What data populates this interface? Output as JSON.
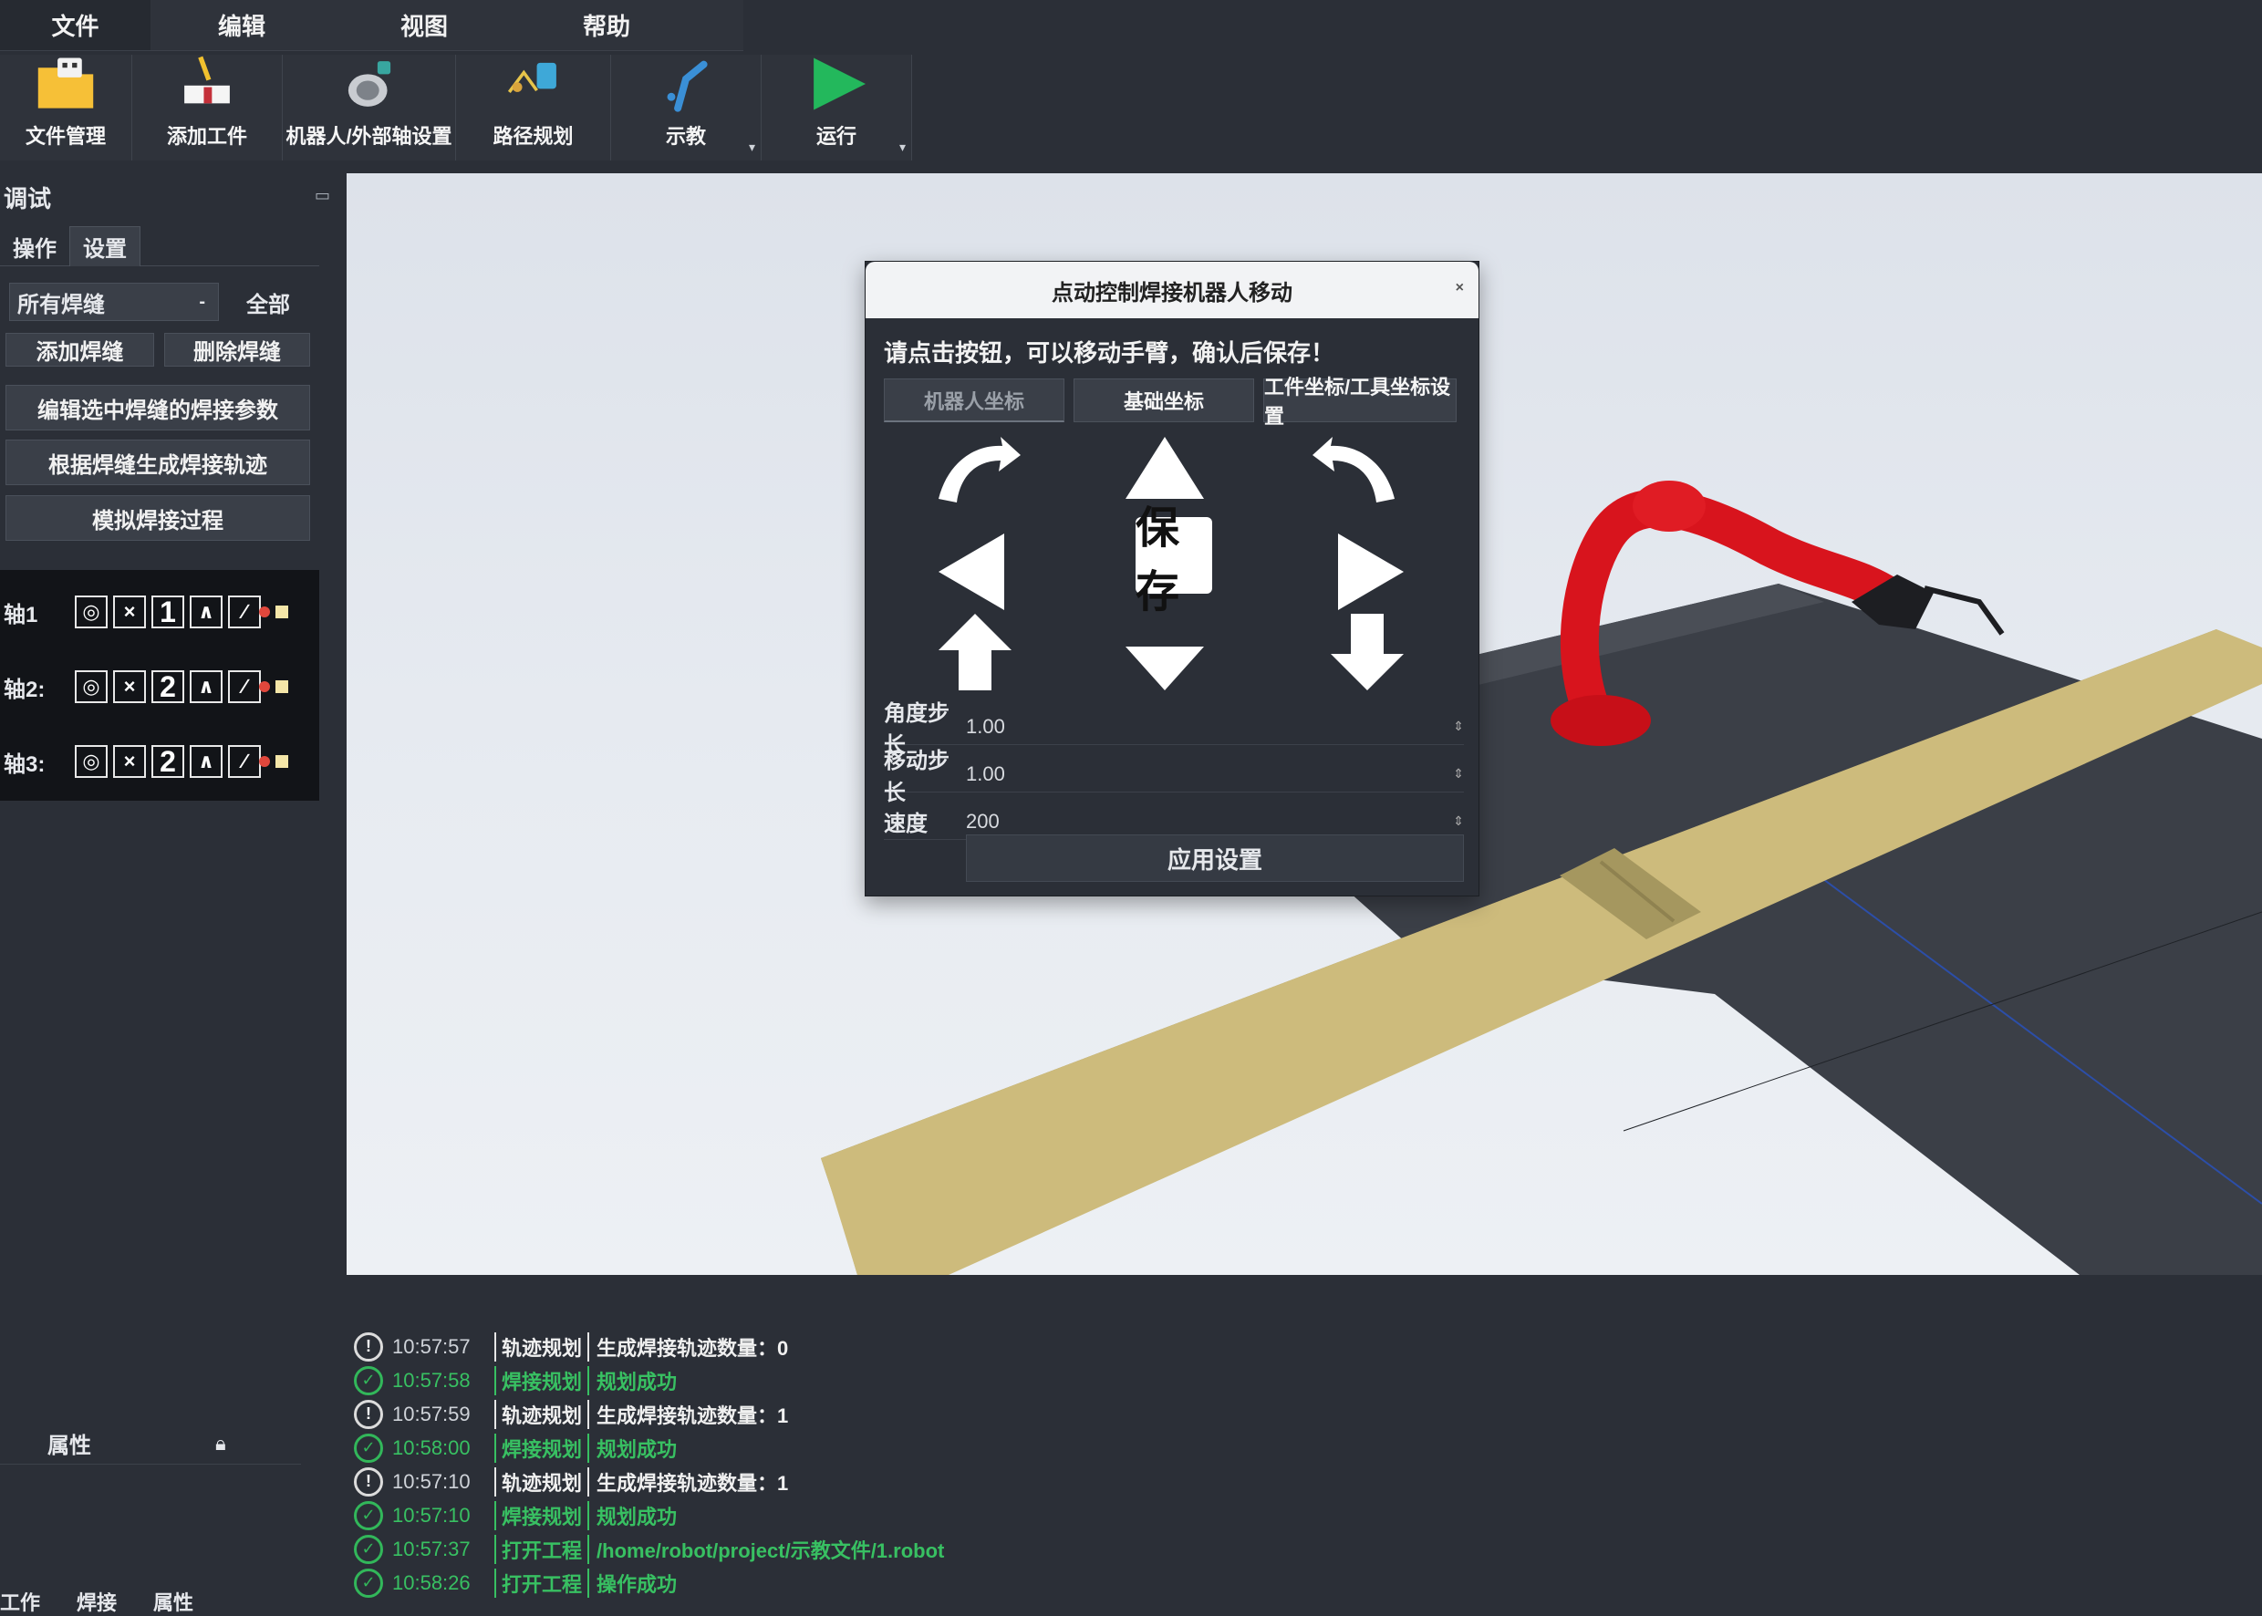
{
  "menu": [
    "文件",
    "编辑",
    "视图",
    "帮助"
  ],
  "toolbar": [
    {
      "label": "文件管理",
      "icon": "folder-icon"
    },
    {
      "label": "添加工件",
      "icon": "workpiece-icon"
    },
    {
      "label": "机器人/外部轴设置",
      "icon": "robot-icon"
    },
    {
      "label": "路径规划",
      "icon": "path-icon"
    },
    {
      "label": "示教",
      "icon": "teach-icon"
    },
    {
      "label": "运行",
      "icon": "play-icon"
    }
  ],
  "left_panel": {
    "title": "调试",
    "tabs": [
      "操作",
      "设置"
    ],
    "select_value": "所有焊缝",
    "pill": "全部",
    "btn_a": "添加焊缝",
    "btn_b": "删除焊缝",
    "btn_wide_1": "编辑选中焊缝的焊接参数",
    "btn_wide_2": "根据焊缝生成焊接轨迹",
    "btn_wide_3": "模拟焊接过程",
    "jog_rows": [
      {
        "label": "轴1",
        "num": "1"
      },
      {
        "label": "轴2:",
        "num": "2"
      },
      {
        "label": "轴3:",
        "num": "2"
      }
    ],
    "lower_title": "属性",
    "lower_icon": "lock-icon",
    "footer": [
      "工作",
      "焊接",
      "属性"
    ]
  },
  "dialog": {
    "title": "点动控制焊接机器人移动",
    "close": "×",
    "tip": "请点击按钮，可以移动手臂，确认后保存！",
    "tabs": [
      "机器人坐标",
      "基础坐标",
      "工件坐标/工具坐标设置"
    ],
    "center_label": "保存",
    "rows": [
      {
        "key": "角度步长",
        "value": "1.00"
      },
      {
        "key": "移动步长",
        "value": "1.00"
      },
      {
        "key": "速度",
        "value": "200"
      }
    ],
    "ok": "应用设置"
  },
  "log": [
    {
      "status": "info",
      "time": "10:57:57",
      "cat": "轨迹规划",
      "msg": "生成焊接轨迹数量：0"
    },
    {
      "status": "ok",
      "time": "10:57:58",
      "cat": "焊接规划",
      "msg": "规划成功"
    },
    {
      "status": "info",
      "time": "10:57:59",
      "cat": "轨迹规划",
      "msg": "生成焊接轨迹数量：1"
    },
    {
      "status": "ok",
      "time": "10:58:00",
      "cat": "焊接规划",
      "msg": "规划成功"
    },
    {
      "status": "info",
      "time": "10:57:10",
      "cat": "轨迹规划",
      "msg": "生成焊接轨迹数量：1"
    },
    {
      "status": "ok",
      "time": "10:57:10",
      "cat": "焊接规划",
      "msg": "规划成功"
    },
    {
      "status": "ok",
      "time": "10:57:37",
      "cat": "打开工程",
      "msg": "/home/robot/project/示教文件/1.robot"
    },
    {
      "status": "ok",
      "time": "10:58:26",
      "cat": "打开工程",
      "msg": "操作成功"
    }
  ]
}
